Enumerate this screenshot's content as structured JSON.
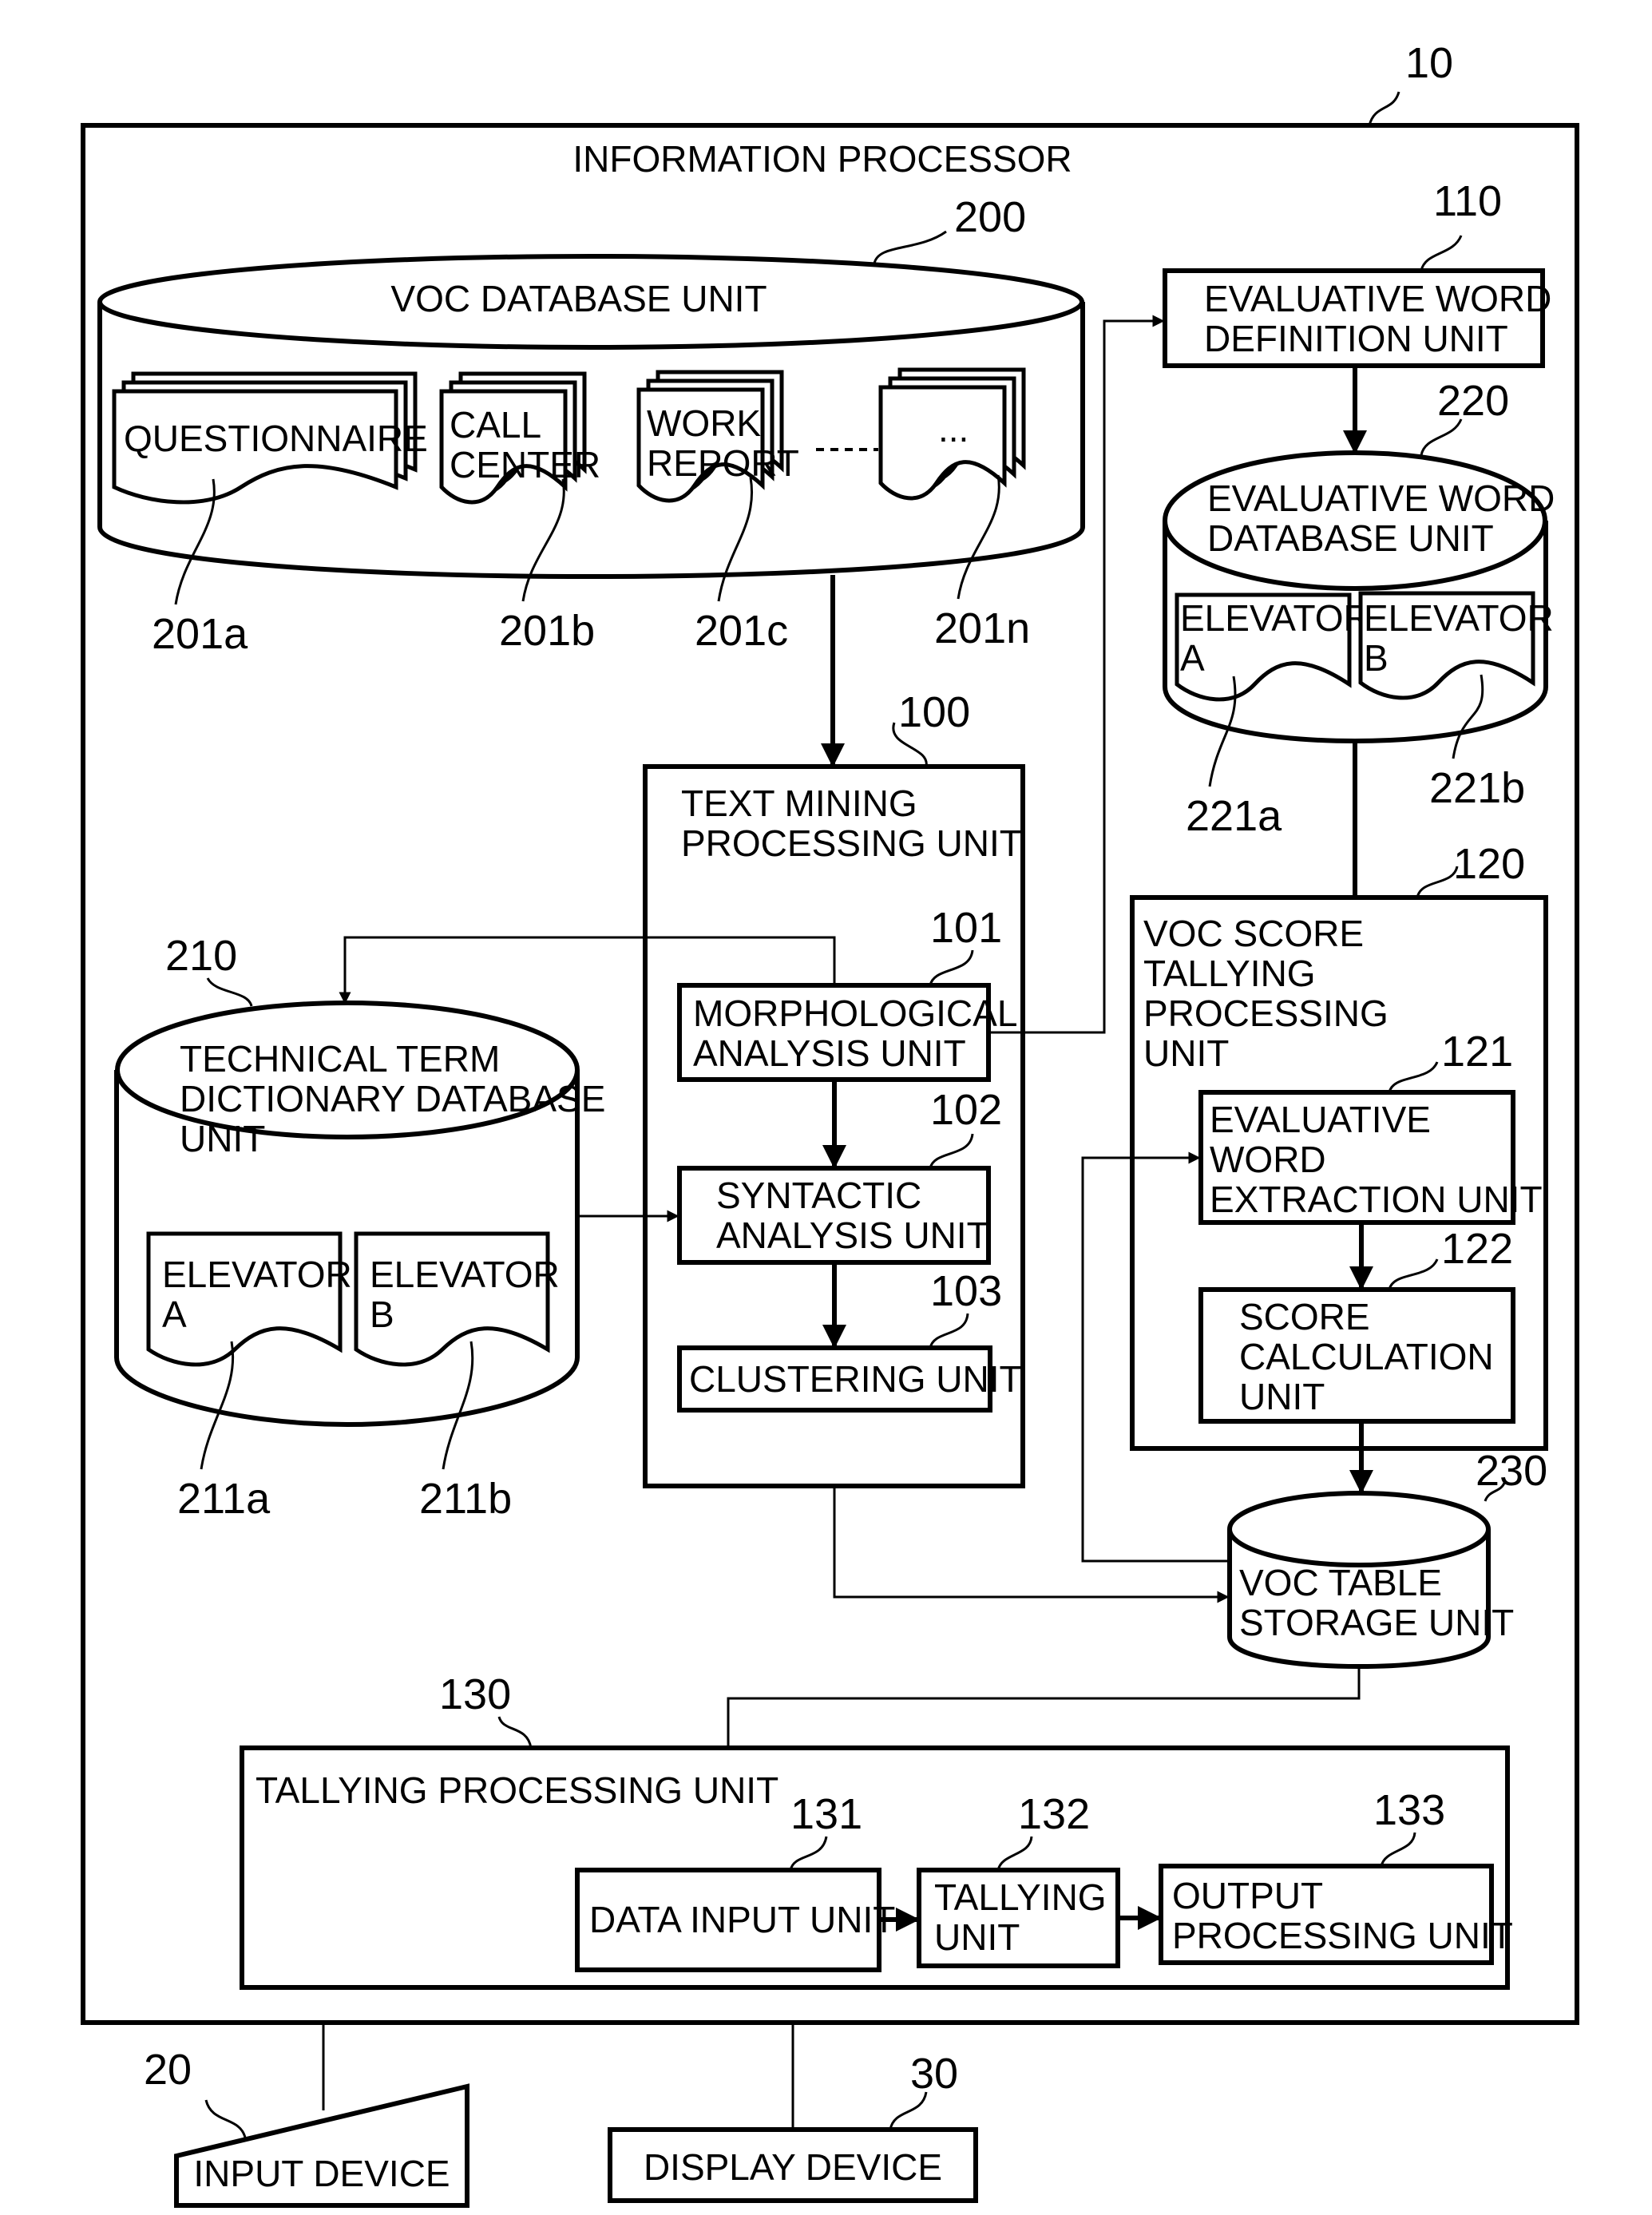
{
  "diagram": {
    "title": "INFORMATION PROCESSOR",
    "ref_processor": "10",
    "voc_db": {
      "label": "VOC DATABASE UNIT",
      "ref": "200",
      "docs": [
        {
          "lines": [
            "QUESTIONNAIRE"
          ],
          "ref": "201a"
        },
        {
          "lines": [
            "CALL",
            "CENTER"
          ],
          "ref": "201b"
        },
        {
          "lines": [
            "WORK",
            "REPORT"
          ],
          "ref": "201c"
        },
        {
          "lines": [
            "..."
          ],
          "ref": "201n"
        }
      ]
    },
    "eval_def": {
      "lines": [
        "EVALUATIVE WORD",
        "DEFINITION UNIT"
      ],
      "ref": "110"
    },
    "eval_db": {
      "lines": [
        "EVALUATIVE WORD",
        "DATABASE UNIT"
      ],
      "ref": "220",
      "docs": [
        {
          "lines": [
            "ELEVATOR",
            "A"
          ],
          "ref": "221a"
        },
        {
          "lines": [
            "ELEVATOR",
            "B"
          ],
          "ref": "221b"
        }
      ]
    },
    "text_mining": {
      "lines": [
        "TEXT MINING",
        "PROCESSING UNIT"
      ],
      "ref": "100",
      "morph": {
        "lines": [
          "MORPHOLOGICAL",
          "ANALYSIS UNIT"
        ],
        "ref": "101"
      },
      "syntactic": {
        "lines": [
          "SYNTACTIC",
          "ANALYSIS UNIT"
        ],
        "ref": "102"
      },
      "clustering": {
        "lines": [
          "CLUSTERING UNIT"
        ],
        "ref": "103"
      }
    },
    "tech_dict": {
      "lines": [
        "TECHNICAL TERM",
        "DICTIONARY DATABASE",
        "UNIT"
      ],
      "ref": "210",
      "docs": [
        {
          "lines": [
            "ELEVATOR",
            "A"
          ],
          "ref": "211a"
        },
        {
          "lines": [
            "ELEVATOR",
            "B"
          ],
          "ref": "211b"
        }
      ]
    },
    "voc_score": {
      "lines": [
        "VOC SCORE",
        "TALLYING",
        "PROCESSING",
        "UNIT"
      ],
      "ref": "120",
      "extraction": {
        "lines": [
          "EVALUATIVE",
          "WORD",
          "EXTRACTION UNIT"
        ],
        "ref": "121"
      },
      "score_calc": {
        "lines": [
          "SCORE",
          "CALCULATION",
          "UNIT"
        ],
        "ref": "122"
      }
    },
    "voc_table": {
      "lines": [
        "VOC TABLE",
        "STORAGE UNIT"
      ],
      "ref": "230"
    },
    "tallying": {
      "label": "TALLYING PROCESSING UNIT",
      "ref": "130",
      "data_input": {
        "lines": [
          "DATA INPUT UNIT"
        ],
        "ref": "131"
      },
      "tally_unit": {
        "lines": [
          "TALLYING",
          "UNIT"
        ],
        "ref": "132"
      },
      "output_proc": {
        "lines": [
          "OUTPUT",
          "PROCESSING UNIT"
        ],
        "ref": "133"
      }
    },
    "input_device": {
      "label": "INPUT DEVICE",
      "ref": "20"
    },
    "display_device": {
      "label": "DISPLAY DEVICE",
      "ref": "30"
    }
  }
}
